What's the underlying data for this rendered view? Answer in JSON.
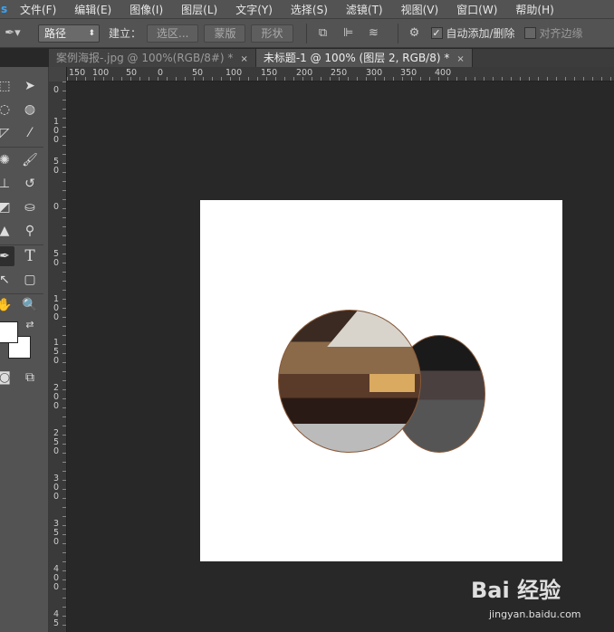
{
  "menu": {
    "logo": "s",
    "items": [
      "文件(F)",
      "编辑(E)",
      "图像(I)",
      "图层(L)",
      "文字(Y)",
      "选择(S)",
      "滤镜(T)",
      "视图(V)",
      "窗口(W)",
      "帮助(H)"
    ]
  },
  "options": {
    "mode": "路径",
    "make_label": "建立：",
    "selection_btn": "选区...",
    "mask_btn": "蒙版",
    "shape_btn": "形状",
    "auto_add_delete": "自动添加/删除",
    "auto_checked": true,
    "align_edges": "对齐边缘",
    "align_checked": false
  },
  "tabs": [
    {
      "label": "案例海报-.jpg @ 100%(RGB/8#) *",
      "close": "×",
      "active": false
    },
    {
      "label": "未标题-1 @ 100% (图层 2, RGB/8) *",
      "close": "×",
      "active": true
    }
  ],
  "hruler": [
    "150",
    "100",
    "50",
    "0",
    "50",
    "100",
    "150",
    "200",
    "250",
    "300",
    "350",
    "400"
  ],
  "vruler": [
    "0",
    "100",
    "50",
    "0",
    "50",
    "100",
    "150",
    "200",
    "250",
    "300",
    "350",
    "400",
    "45"
  ],
  "watermark": {
    "main": "Bai 经验",
    "sub": "jingyan.baidu.com"
  }
}
